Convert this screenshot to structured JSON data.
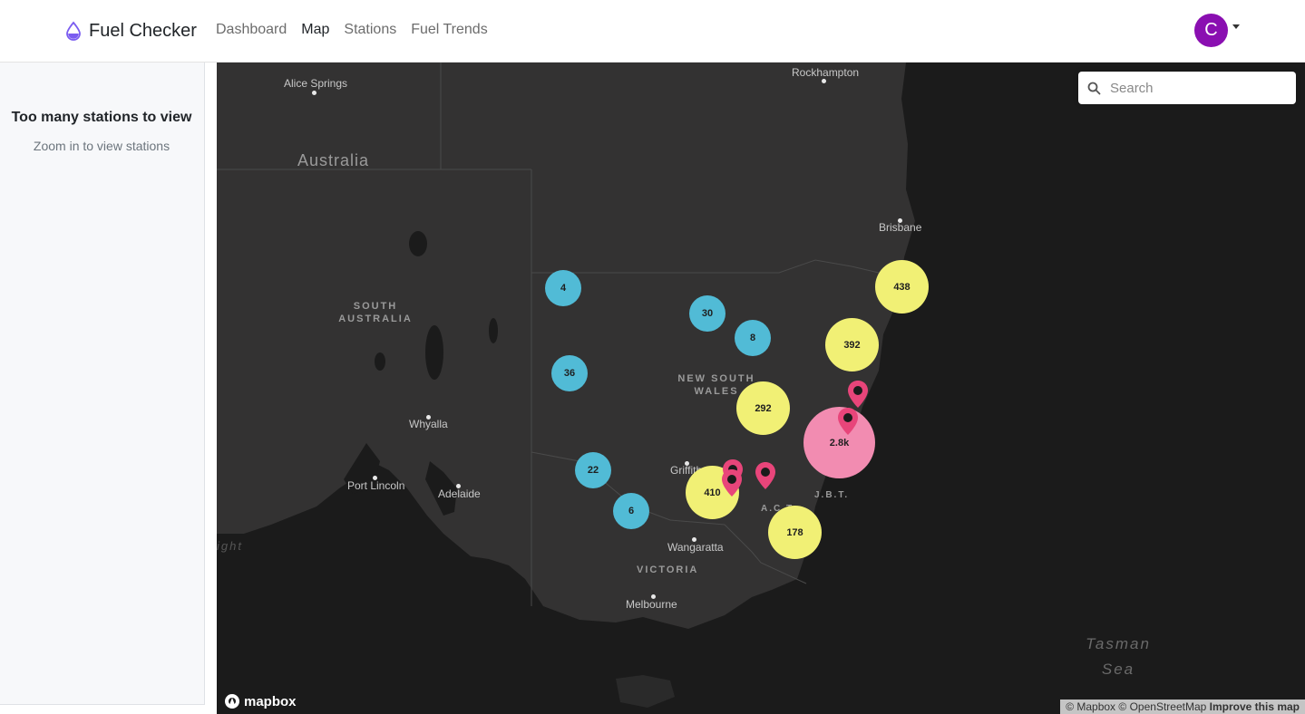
{
  "app": {
    "title": "Fuel Checker"
  },
  "nav": {
    "links": [
      {
        "label": "Dashboard",
        "active": false
      },
      {
        "label": "Map",
        "active": true
      },
      {
        "label": "Stations",
        "active": false
      },
      {
        "label": "Fuel Trends",
        "active": false
      }
    ],
    "user_initial": "C",
    "avatar_color": "#8a0fb1"
  },
  "sidebar": {
    "title": "Too many stations to view",
    "subtitle": "Zoom in to view stations"
  },
  "map": {
    "search_placeholder": "Search",
    "country": "Australia",
    "regions": {
      "south_australia": [
        "SOUTH",
        "AUSTRALIA"
      ],
      "new_south_wales": [
        "NEW SOUTH",
        "WALES"
      ],
      "victoria": "VICTORIA",
      "act": "A.C.T",
      "jbt": "J.B.T."
    },
    "sea": [
      "Tasman",
      "Sea"
    ],
    "bight_fragment": "ight",
    "cities": {
      "rockhampton": "Rockhampton",
      "alice_springs": "Alice Springs",
      "brisbane": "Brisbane",
      "whyalla": "Whyalla",
      "port_lincoln": "Port Lincoln",
      "adelaide": "Adelaide",
      "griffith": "Griffith",
      "wangaratta": "Wangaratta",
      "melbourne": "Melbourne"
    },
    "clusters": {
      "c4": "4",
      "c30": "30",
      "c8": "8",
      "c36": "36",
      "c22": "22",
      "c6": "6",
      "c438": "438",
      "c392": "392",
      "c292": "292",
      "c410": "410",
      "c178": "178",
      "c2800": "2.8k"
    },
    "cluster_colors": {
      "small": "#51bbd6",
      "medium": "#f1f075",
      "large": "#f28cb1"
    },
    "pin_color": "#e8457a",
    "logo": "mapbox",
    "attribution": {
      "mapbox": "© Mapbox",
      "osm": "© OpenStreetMap",
      "improve": "Improve this map"
    }
  }
}
